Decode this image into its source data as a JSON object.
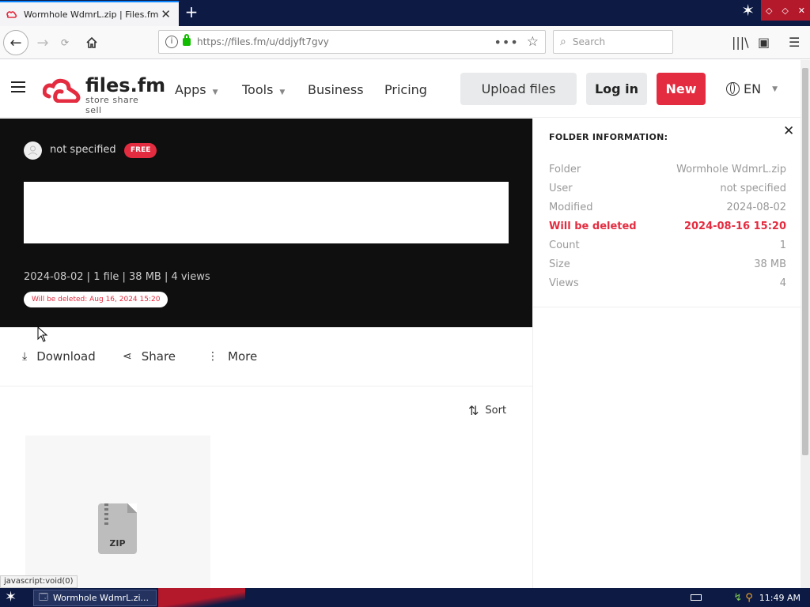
{
  "browser": {
    "tab_title": "Wormhole WdmrL.zip | Files.fm.",
    "url": "https://files.fm/u/ddjyft7gvy",
    "search_placeholder": "Search"
  },
  "site": {
    "brand": "files.fm",
    "tagline": "store share sell",
    "nav": [
      "Apps",
      "Tools",
      "Business",
      "Pricing"
    ],
    "upload_label": "Upload files",
    "login_label": "Log in",
    "new_label": "New",
    "lang": "EN"
  },
  "hero": {
    "owner": "not specified",
    "plan_badge": "FREE",
    "meta": "2024-08-02 | 1 file | 38 MB | 4 views",
    "deletion_notice": "Will be deleted: Aug 16, 2024 15:20"
  },
  "actions": {
    "download": "Download",
    "share": "Share",
    "more": "More",
    "sort": "Sort"
  },
  "file": {
    "type_label": "ZIP"
  },
  "info": {
    "title": "FOLDER INFORMATION:",
    "rows": [
      {
        "k": "Folder",
        "v": "Wormhole WdmrL.zip"
      },
      {
        "k": "User",
        "v": "not specified"
      },
      {
        "k": "Modified",
        "v": "2024-08-02"
      },
      {
        "k": "Will be deleted",
        "v": "2024-08-16 15:20"
      },
      {
        "k": "Count",
        "v": "1"
      },
      {
        "k": "Size",
        "v": "38 MB"
      },
      {
        "k": "Views",
        "v": "4"
      }
    ]
  },
  "status_text": "javascript:void(0)",
  "taskbar": {
    "window_label": "Wormhole WdmrL.zi...",
    "clock": "11:49 AM"
  },
  "colors": {
    "brand_red": "#e42c40",
    "hero_bg": "#0f0f0f",
    "taskbar_bg": "#0c1a44"
  }
}
